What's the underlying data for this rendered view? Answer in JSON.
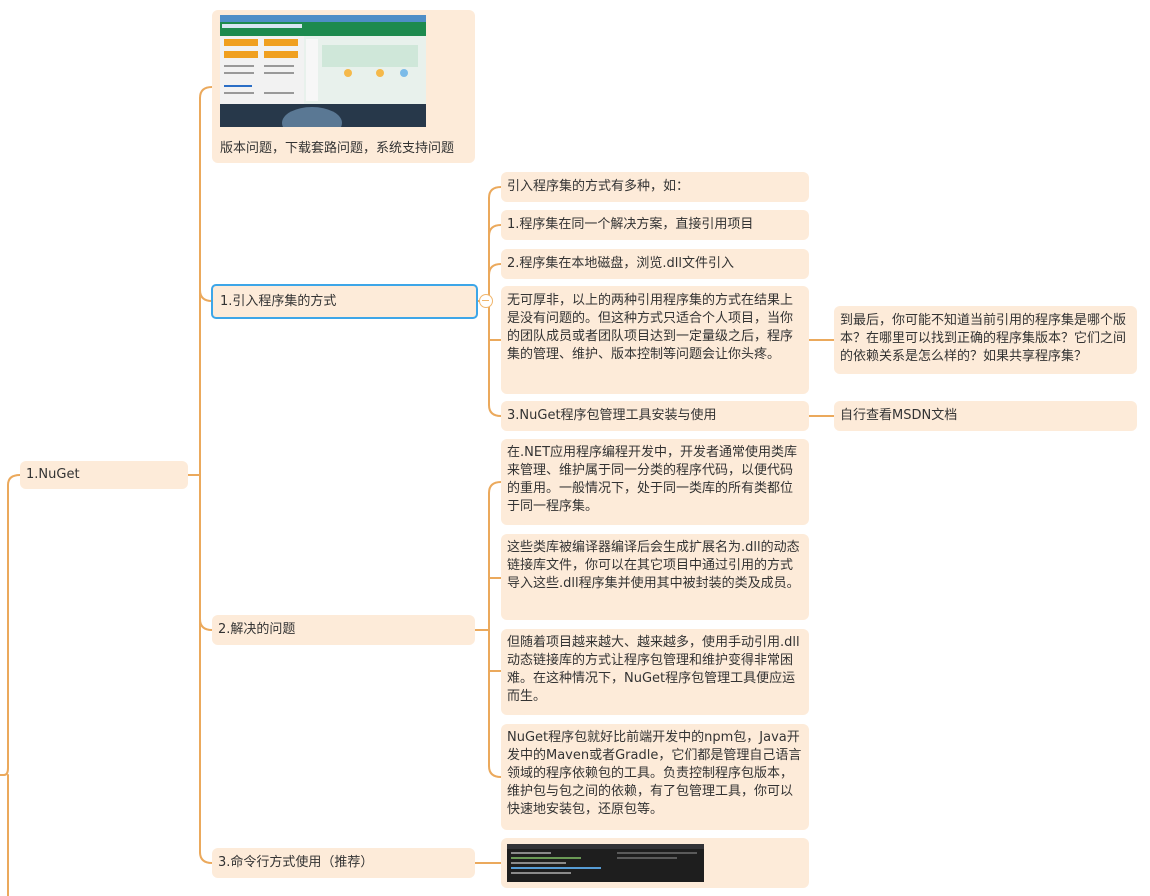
{
  "colors": {
    "connector": "#eba95c",
    "node_fill": "#fdebd9",
    "selected_border": "#3da6e8",
    "text": "#333333"
  },
  "nodes": {
    "nuget": "1.NuGet",
    "problems_caption": "版本问题，下载套路问题，系统支持问题",
    "ways_title": "1.引入程序集的方式",
    "ways_intro": "引入程序集的方式有多种，如：",
    "ways_same_solution": "1.程序集在同一个解决方案，直接引用项目",
    "ways_local_disk": "2.程序集在本地磁盘，浏览.dll文件引入",
    "ways_comment": "无可厚非，以上的两种引用程序集的方式在结果上是没有问题的。但这种方式只适合个人项目，当你的团队成员或者团队项目达到一定量级之后，程序集的管理、维护、版本控制等问题会让你头疼。",
    "ways_question": "到最后，你可能不知道当前引用的程序集是哪个版本？在哪里可以找到正确的程序集版本？它们之间的依赖关系是怎么样的？如果共享程序集？",
    "ways_install": "3.NuGet程序包管理工具安装与使用",
    "ways_msdn": "自行查看MSDN文档",
    "solve_title": "2.解决的问题",
    "solve_p1": "在.NET应用程序编程开发中，开发者通常使用类库来管理、维护属于同一分类的程序代码，以便代码的重用。一般情况下，处于同一类库的所有类都位于同一程序集。",
    "solve_p2": "这些类库被编译器编译后会生成扩展名为.dll的动态链接库文件，你可以在其它项目中通过引用的方式导入这些.dll程序集并使用其中被封装的类及成员。",
    "solve_p3": "但随着项目越来越大、越来越多，使用手动引用.dll动态链接库的方式让程序包管理和维护变得非常困难。在这种情况下，NuGet程序包管理工具便应运而生。",
    "solve_p4": "NuGet程序包就好比前端开发中的npm包，Java开发中的Maven或者Gradle，它们都是管理自己语言领域的程序依赖包的工具。负责控制程序包版本，维护包与包之间的依赖，有了包管理工具，你可以快速地安装包，还原包等。",
    "cli_title": "3.命令行方式使用（推荐）"
  }
}
